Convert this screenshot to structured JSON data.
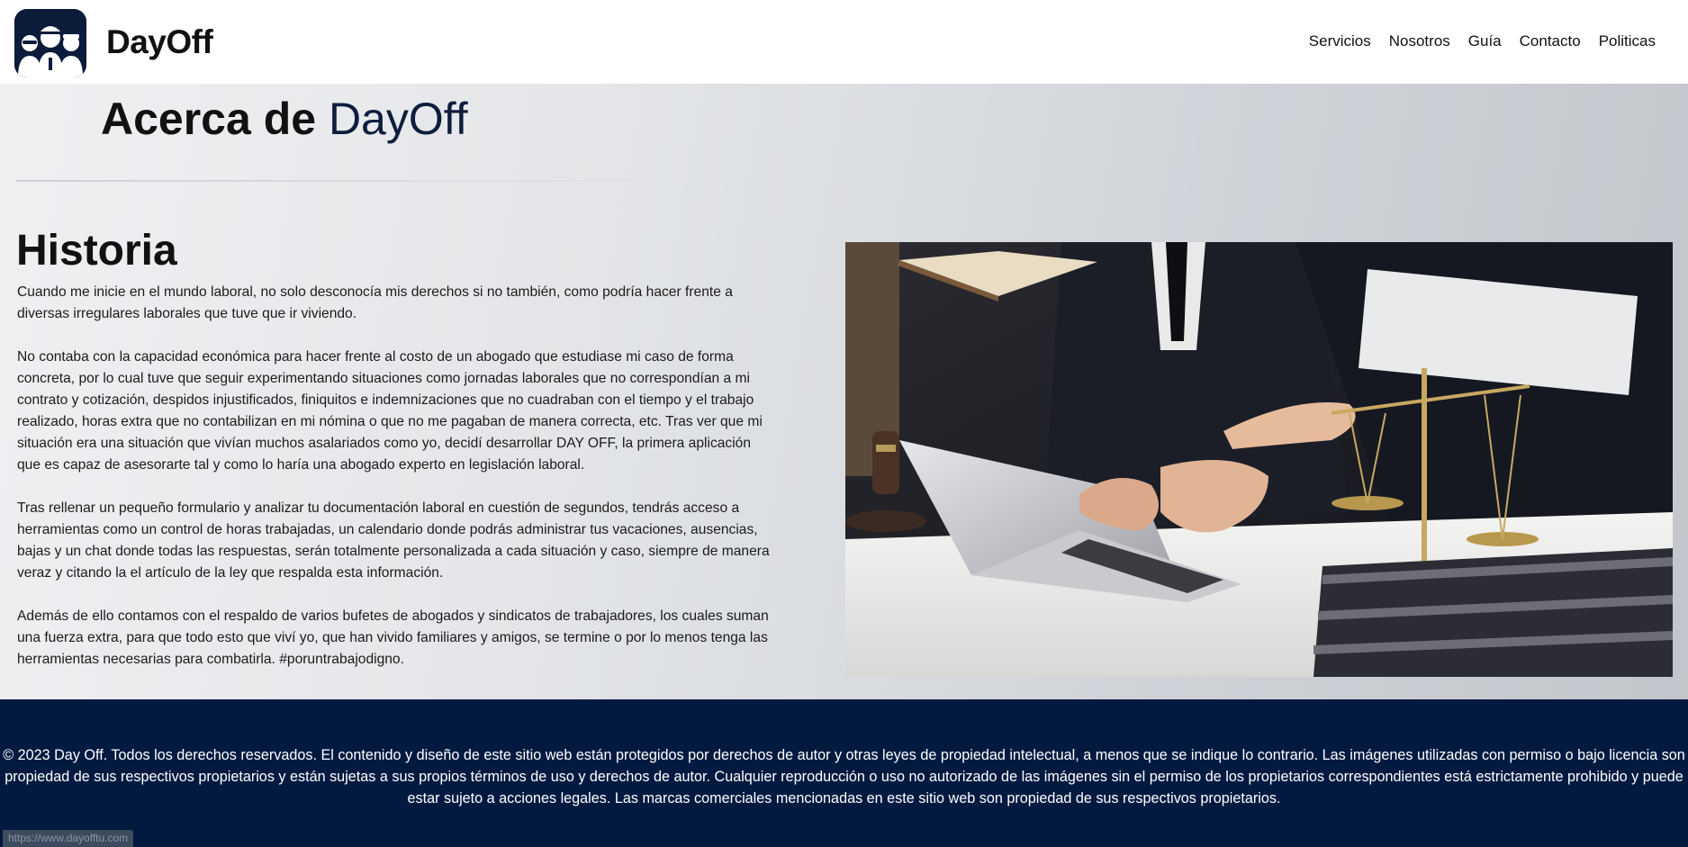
{
  "header": {
    "brand": "DayOff",
    "nav": [
      "Servicios",
      "Nosotros",
      "Guía",
      "Contacto",
      "Politicas"
    ]
  },
  "about": {
    "title_prefix": "Acerca de ",
    "title_accent": "DayOff"
  },
  "history": {
    "title": "Historia",
    "paragraphs": [
      "Cuando me inicie en el mundo laboral, no solo desconocía mis derechos si no también, como podría hacer frente a diversas irregulares laborales que tuve que ir viviendo.",
      "No contaba con la capacidad económica para hacer frente al costo de un abogado que estudiase mi caso de forma concreta, por lo cual tuve que seguir experimentando situaciones como jornadas laborales que no correspondían a mi contrato y cotización, despidos injustificados, finiquitos e indemnizaciones que no cuadraban con el tiempo y el trabajo realizado, horas extra que no contabilizan en mi nómina o que no me pagaban de manera correcta, etc. Tras ver que mi situación era una situación que vivían muchos asalariados como yo, decidí desarrollar DAY OFF, la primera aplicación que es capaz de asesorarte tal y como lo haría una abogado experto en legislación laboral.",
      "Tras rellenar un pequeño formulario y analizar tu documentación laboral en cuestión de segundos, tendrás acceso a herramientas como un control de horas trabajadas, un calendario donde podrás administrar tus vacaciones, ausencias, bajas y un chat donde todas las respuestas, serán totalmente personalizada a cada situación y caso, siempre de manera veraz y citando la el artículo de la ley que respalda esta información.",
      "Además de ello contamos con el respaldo de varios bufetes de abogados y sindicatos de trabajadores, los cuales suman una fuerza extra, para que todo esto que viví yo, que han vivido familiares y amigos, se termine o por lo menos tenga las herramientas necesarias para combatirla. #poruntrabajodigno."
    ]
  },
  "footer": {
    "text": "© 2023 Day Off. Todos los derechos reservados. El contenido y diseño de este sitio web están protegidos por derechos de autor y otras leyes de propiedad intelectual, a menos que se indique lo contrario. Las imágenes utilizadas con permiso o bajo licencia son propiedad de sus respectivos propietarios y están sujetas a sus propios términos de uso y derechos de autor. Cualquier reproducción o uso no autorizado de las imágenes sin el permiso de los propietarios correspondientes está estrictamente prohibido y puede estar sujeto a acciones legales. Las marcas comerciales mencionadas en este sitio web son propiedad de sus respectivos propietarios."
  },
  "status_bar": {
    "url": "https://www.dayofftu.com"
  },
  "colors": {
    "accent": "#0d1e3d",
    "footer_bg": "#021a40",
    "logo_bg": "#0b1b3a"
  }
}
